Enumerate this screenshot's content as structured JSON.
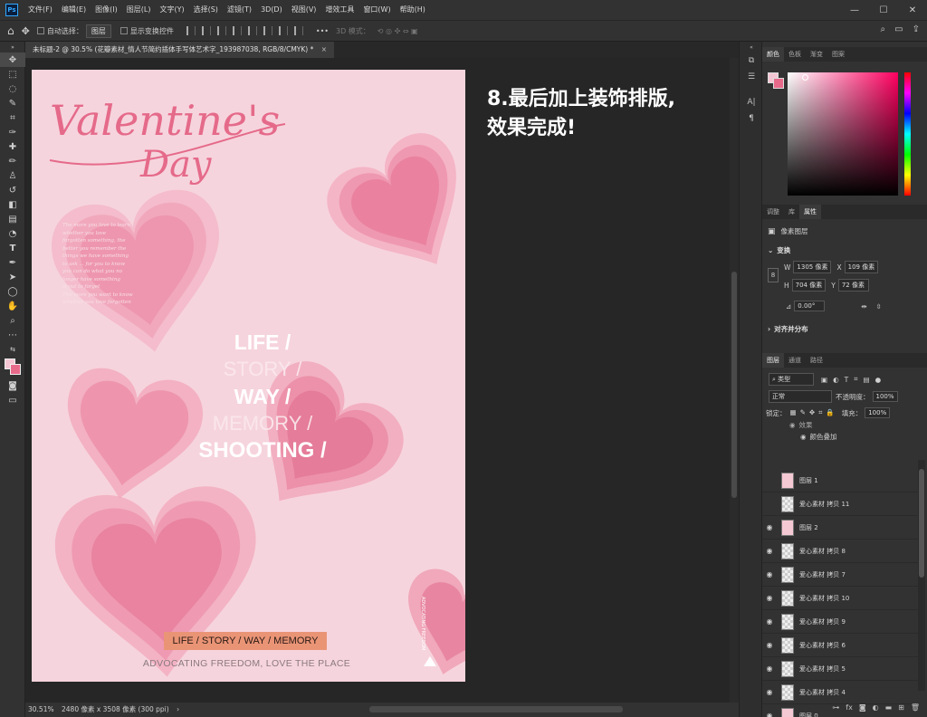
{
  "menubar": {
    "logo": "Ps",
    "items": [
      "文件(F)",
      "编辑(E)",
      "图像(I)",
      "图层(L)",
      "文字(Y)",
      "选择(S)",
      "滤镜(T)",
      "3D(D)",
      "视图(V)",
      "增效工具",
      "窗口(W)",
      "帮助(H)"
    ]
  },
  "options": {
    "auto_select_label": "自动选择：",
    "auto_select_value": "图层",
    "transform_label": "显示变换控件",
    "mode3d_label": "3D 模式："
  },
  "document": {
    "tab_title": "未标题-2 @ 30.5% (花瓣素材_情人节简约插体手写体艺术字_193987038, RGB/8/CMYK) *",
    "close": "×"
  },
  "poster": {
    "title_line1": "Valentine's",
    "title_line2": "Day",
    "lines": [
      {
        "text": "LIFE /",
        "style": "bold"
      },
      {
        "text": "STORY /",
        "style": "thin"
      },
      {
        "text": "WAY /",
        "style": "bold"
      },
      {
        "text": "MEMORY /",
        "style": "thin"
      },
      {
        "text": "SHOOTING /",
        "style": "bold"
      }
    ],
    "poem": [
      "The more you love to learn",
      "whether you love",
      "forgotten something, the",
      "better you remember the",
      "things we have something",
      "to ask ... for you to know",
      "you can do what you no",
      "longer have something",
      "is out to forget",
      "The more you want to know",
      "whether you love forgotten"
    ],
    "banner": "LIFE / STORY / WAY / MEMORY",
    "footer": "ADVOCATING FREEDOM, LOVE THE PLACE",
    "vertical_text": "ADVOCATING FREEDOM"
  },
  "caption": {
    "line1": "8.最后加上装饰排版,",
    "line2": "效果完成!"
  },
  "status": {
    "zoom": "30.51%",
    "info": "2480 像素 x 3508 像素 (300 ppi)"
  },
  "color_panel": {
    "tabs": [
      "颜色",
      "色板",
      "渐变",
      "图案"
    ],
    "fg": "#f4c6d3",
    "bg": "#e86a8b"
  },
  "props_panel": {
    "tabs": [
      "调整",
      "库",
      "属性"
    ],
    "pixel_layer": "像素图层",
    "transform": "变换",
    "w_label": "W",
    "w": "1305 像素",
    "x_label": "X",
    "x": "109 像素",
    "h_label": "H",
    "h": "704 像素",
    "y_label": "Y",
    "y": "72 像素",
    "angle": "0.00°",
    "align": "对齐并分布"
  },
  "layers_panel": {
    "tabs": [
      "图层",
      "通道",
      "路径"
    ],
    "filter": "类型",
    "blend": "正常",
    "opacity_label": "不透明度：",
    "opacity": "100%",
    "lock_label": "锁定：",
    "fill_label": "填充：",
    "fill": "100%",
    "effects": "效果",
    "color_overlay": "颜色叠加",
    "layers": [
      {
        "name": "图层 1",
        "visible": false,
        "thumb": "pink"
      },
      {
        "name": "爱心素材 拷贝 11",
        "visible": false,
        "thumb": "checker"
      },
      {
        "name": "图层 2",
        "visible": true,
        "thumb": "pink"
      },
      {
        "name": "爱心素材 拷贝 8",
        "visible": true,
        "thumb": "checker"
      },
      {
        "name": "爱心素材 拷贝 7",
        "visible": true,
        "thumb": "checker"
      },
      {
        "name": "爱心素材 拷贝 10",
        "visible": true,
        "thumb": "checker"
      },
      {
        "name": "爱心素材 拷贝 9",
        "visible": true,
        "thumb": "checker"
      },
      {
        "name": "爱心素材 拷贝 6",
        "visible": true,
        "thumb": "checker"
      },
      {
        "name": "爱心素材 拷贝 5",
        "visible": true,
        "thumb": "checker"
      },
      {
        "name": "爱心素材 拷贝 4",
        "visible": true,
        "thumb": "checker"
      },
      {
        "name": "图层 0",
        "visible": true,
        "thumb": "pink"
      }
    ]
  }
}
